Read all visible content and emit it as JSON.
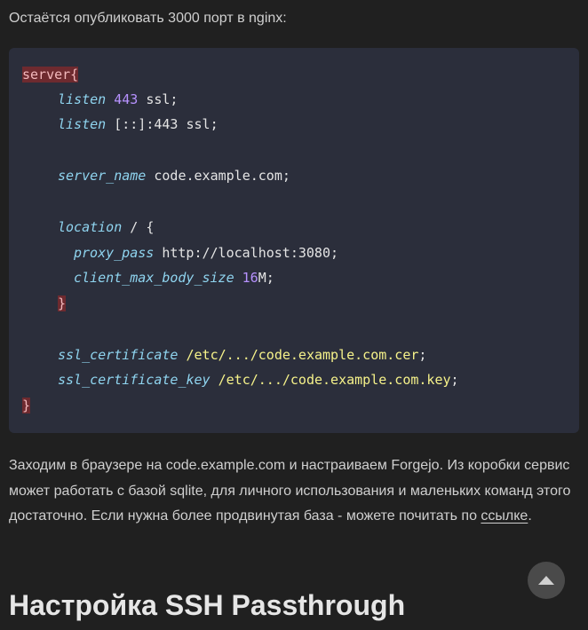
{
  "intro_text": "Остаётся опубликовать 3000 порт в nginx:",
  "code": {
    "server_kw": "server{",
    "listen1_dir": "listen",
    "listen1_num": "443",
    "listen1_rest": " ssl;",
    "listen2_dir": "listen",
    "listen2_rest": " [::]:443 ssl;",
    "server_name_dir": "server_name",
    "server_name_rest": " code.example.com;",
    "location_dir": "location",
    "location_rest": " / {",
    "proxy_pass_dir": "proxy_pass",
    "proxy_pass_rest": " http://localhost:3080;",
    "cmbs_dir": "client_max_body_size",
    "cmbs_num": "16",
    "cmbs_rest": "M;",
    "location_close": "}",
    "ssl_cert_dir": "ssl_certificate",
    "ssl_cert_path": "/etc/.../code.example.com.cer",
    "ssl_cert_end": ";",
    "ssl_key_dir": "ssl_certificate_key",
    "ssl_key_path": "/etc/.../code.example.com.key",
    "ssl_key_end": ";",
    "server_close": "}"
  },
  "paragraph": {
    "text": "Заходим в браузере на code.example.com и настраиваем Forgejo. Из коробки сервис может работать с базой sqlite, для личного использования и маленьких команд этого достаточно. Если нужна более продвинутая база - можете почитать по ",
    "link_text": "ссылке",
    "tail": "."
  },
  "heading": "Настройка SSH Passthrough",
  "scroll_top_icon": "chevron-up-icon",
  "colors": {
    "background": "#202020",
    "code_background": "#2b2e3b",
    "directive": "#8fd4ef",
    "number": "#b792ff",
    "path": "#f6f28a",
    "error_bg": "#6e2a2f"
  }
}
